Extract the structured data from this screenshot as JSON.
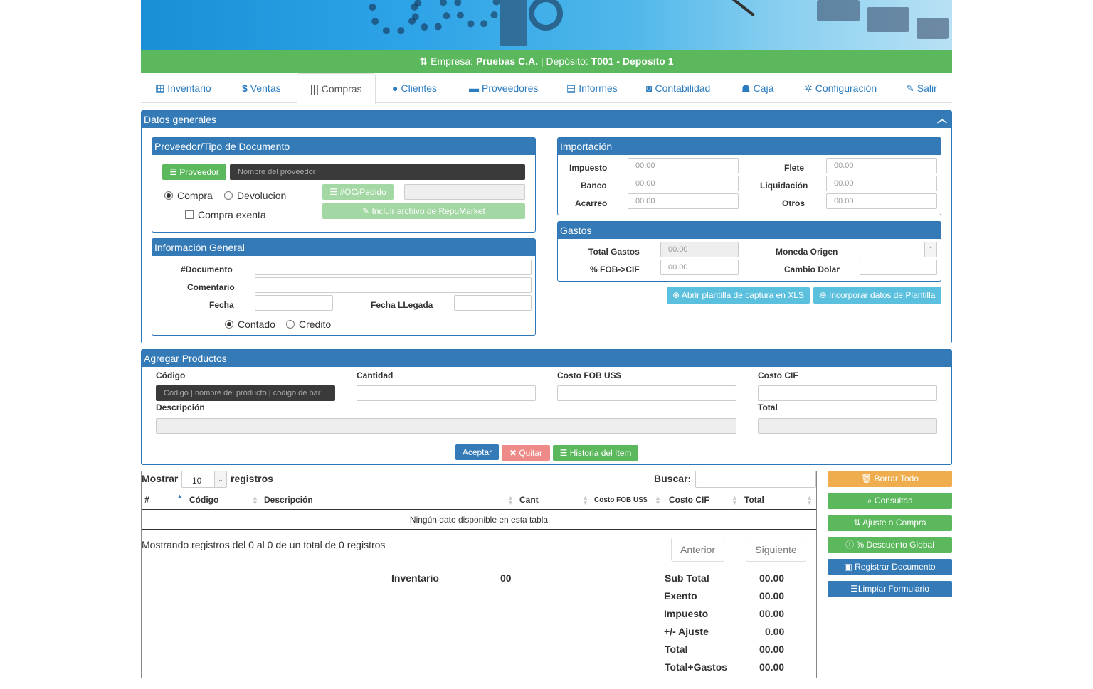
{
  "company_bar": {
    "empresa_label": "Empresa:",
    "empresa_value": "Pruebas C.A.",
    "separator": "|",
    "deposito_label": "Depósito:",
    "deposito_value": "T001 - Deposito 1"
  },
  "nav": {
    "tabs": [
      {
        "label": "Inventario",
        "icon": "grid-icon"
      },
      {
        "label": "Ventas",
        "icon": "dollar-icon"
      },
      {
        "label": "Compras",
        "icon": "barcode-icon"
      },
      {
        "label": "Clientes",
        "icon": "user-icon"
      },
      {
        "label": "Proveedores",
        "icon": "briefcase-icon"
      },
      {
        "label": "Informes",
        "icon": "print-icon"
      },
      {
        "label": "Contabilidad",
        "icon": "hdd-icon"
      },
      {
        "label": "Caja",
        "icon": "piggy-icon"
      },
      {
        "label": "Configuración",
        "icon": "cog-icon"
      },
      {
        "label": "Salir",
        "icon": "pushpin-icon"
      }
    ],
    "active": "Compras"
  },
  "datos_generales": {
    "title": "Datos generales",
    "proveedor": {
      "title": "Proveedor/Tipo de Documento",
      "proveedor_button": "Proveedor",
      "proveedor_placeholder": "Nombre del proveedor",
      "compra": "Compra",
      "devolucion": "Devolucion",
      "compra_exenta": "Compra exenta",
      "oc_button": "#OC/Pedido",
      "repumarket_button": "Incluir archivo de RepuMarket"
    },
    "info_general": {
      "title": "Información General",
      "documento": "#Documento",
      "comentario": "Comentario",
      "fecha": "Fecha",
      "fecha_llegada": "Fecha LLegada",
      "contado": "Contado",
      "credito": "Credito"
    },
    "importacion": {
      "title": "Importación",
      "impuesto": "Impuesto",
      "banco": "Banco",
      "acarreo": "Acarreo",
      "flete": "Flete",
      "liquidacion": "Liquidación",
      "otros": "Otros",
      "placeholder": "00.00"
    },
    "gastos": {
      "title": "Gastos",
      "total_gastos": "Total Gastos",
      "fob_cif": "% FOB->CIF",
      "moneda_origen": "Moneda Origen",
      "cambio_dolar": "Cambio Dolar",
      "placeholder": "00.00"
    },
    "abrir_plantilla": "Abrir plantilla de captura en XLS",
    "incorporar_plantilla": "Incorporar datos de Plantilla"
  },
  "agregar_productos": {
    "title": "Agregar Productos",
    "codigo": "Código",
    "codigo_placeholder": "Código | nombre del producto | codigo de bar",
    "cantidad": "Cantidad",
    "costo_fob": "Costo FOB US$",
    "costo_cif": "Costo CIF",
    "descripcion": "Descripción",
    "total": "Total",
    "aceptar": "Aceptar",
    "quitar": "Quitar",
    "historia": "Historia del Item"
  },
  "table": {
    "mostrar": "Mostrar",
    "page_size": "10",
    "registros": "registros",
    "buscar": "Buscar:",
    "columns": [
      "#",
      "Código",
      "Descripción",
      "Cant",
      "Costo FOB US$",
      "Costo CIF",
      "Total"
    ],
    "empty": "Ningún dato disponible en esta tabla",
    "info": "Mostrando registros del 0 al 0 de un total de 0 registros",
    "anterior": "Anterior",
    "siguiente": "Siguiente"
  },
  "summary": {
    "inventario_label": "Inventario",
    "inventario_value": "00",
    "rows": [
      {
        "label": "Sub Total",
        "value": "00.00"
      },
      {
        "label": "Exento",
        "value": "00.00"
      },
      {
        "label": "Impuesto",
        "value": "00.00"
      },
      {
        "label": "+/- Ajuste",
        "value": "0.00"
      },
      {
        "label": "Total",
        "value": "00.00"
      },
      {
        "label": "Total+Gastos",
        "value": "00.00"
      }
    ]
  },
  "side_actions": {
    "borrar": "Borrar Todo",
    "consultas": "Consultas",
    "ajuste": "Ajuste a Compra",
    "descuento": "% Descuento Global",
    "registrar": "Registrar Documento",
    "limpiar": "Limpiar Formulario"
  },
  "colors": {
    "primary": "#337ab7",
    "success": "#5cb85c",
    "info": "#5bc0de",
    "warning": "#f0ad4e",
    "danger": "#d9534f"
  }
}
